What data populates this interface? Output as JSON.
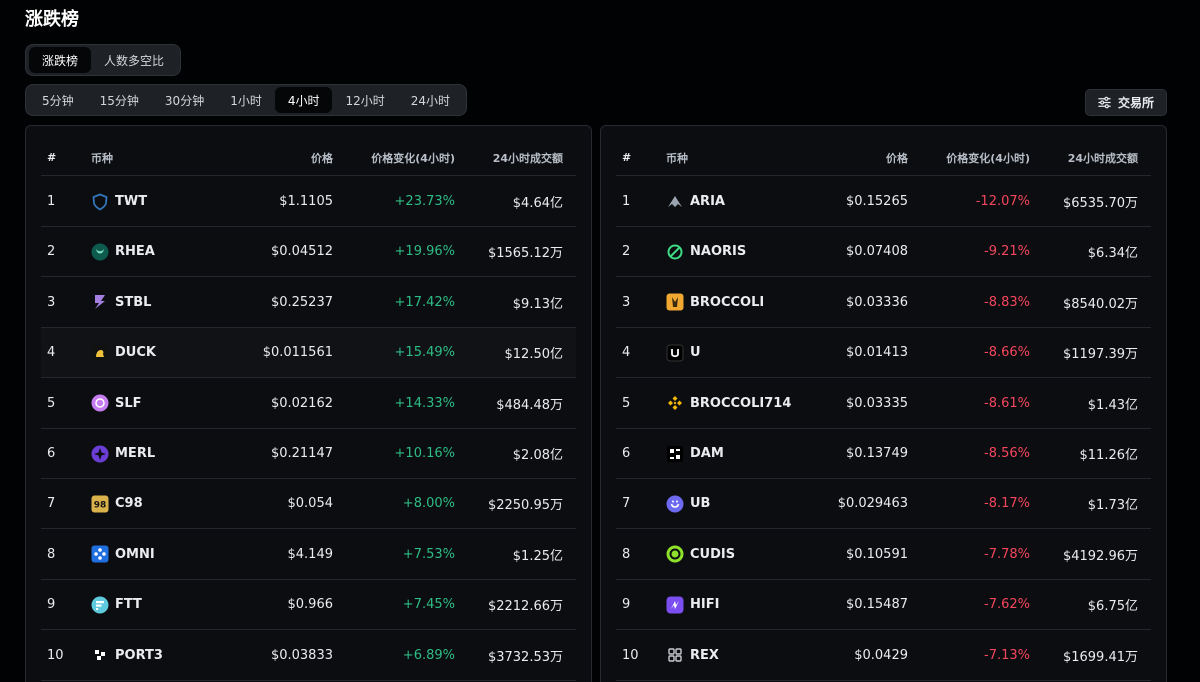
{
  "page": {
    "title": "涨跌榜"
  },
  "main_tabs": [
    {
      "label": "涨跌榜",
      "active": true
    },
    {
      "label": "人数多空比",
      "active": false
    }
  ],
  "time_tabs": [
    {
      "label": "5分钟",
      "active": false
    },
    {
      "label": "15分钟",
      "active": false
    },
    {
      "label": "30分钟",
      "active": false
    },
    {
      "label": "1小时",
      "active": false
    },
    {
      "label": "4小时",
      "active": true
    },
    {
      "label": "12小时",
      "active": false
    },
    {
      "label": "24小时",
      "active": false
    }
  ],
  "exchange_button": {
    "label": "交易所",
    "icon": "sliders-icon"
  },
  "columns": {
    "rank": "#",
    "coin": "币种",
    "price": "价格",
    "change": "价格变化(4小时)",
    "volume": "24小时成交额"
  },
  "colors": {
    "up": "#2ebd85",
    "down": "#f6465d",
    "background": "#010203",
    "panel": "#0b0d10"
  },
  "gainers": [
    {
      "rank": "1",
      "symbol": "TWT",
      "price": "$1.1105",
      "change": "+23.73%",
      "volume": "$4.64亿",
      "icon": "twt-shield-icon",
      "color": "#3375bb"
    },
    {
      "rank": "2",
      "symbol": "RHEA",
      "price": "$0.04512",
      "change": "+19.96%",
      "volume": "$1565.12万",
      "icon": "rhea-icon",
      "color": "#0e5a4c"
    },
    {
      "rank": "3",
      "symbol": "STBL",
      "price": "$0.25237",
      "change": "+17.42%",
      "volume": "$9.13亿",
      "icon": "stbl-icon",
      "color": "#a47fe0"
    },
    {
      "rank": "4",
      "symbol": "DUCK",
      "price": "$0.011561",
      "change": "+15.49%",
      "volume": "$12.50亿",
      "icon": "duck-icon",
      "color": "#f0c23b"
    },
    {
      "rank": "5",
      "symbol": "SLF",
      "price": "$0.02162",
      "change": "+14.33%",
      "volume": "$484.48万",
      "icon": "slf-icon",
      "color": "#c57df0"
    },
    {
      "rank": "6",
      "symbol": "MERL",
      "price": "$0.21147",
      "change": "+10.16%",
      "volume": "$2.08亿",
      "icon": "merl-icon",
      "color": "#6b3fd6"
    },
    {
      "rank": "7",
      "symbol": "C98",
      "price": "$0.054",
      "change": "+8.00%",
      "volume": "$2250.95万",
      "icon": "c98-icon",
      "color": "#d9b24c"
    },
    {
      "rank": "8",
      "symbol": "OMNI",
      "price": "$4.149",
      "change": "+7.53%",
      "volume": "$1.25亿",
      "icon": "omni-icon",
      "color": "#1f6fe0"
    },
    {
      "rank": "9",
      "symbol": "FTT",
      "price": "$0.966",
      "change": "+7.45%",
      "volume": "$2212.66万",
      "icon": "ftt-icon",
      "color": "#5fcade"
    },
    {
      "rank": "10",
      "symbol": "PORT3",
      "price": "$0.03833",
      "change": "+6.89%",
      "volume": "$3732.53万",
      "icon": "port3-icon",
      "color": "#ffffff"
    }
  ],
  "losers": [
    {
      "rank": "1",
      "symbol": "ARIA",
      "price": "$0.15265",
      "change": "-12.07%",
      "volume": "$6535.70万",
      "icon": "aria-icon",
      "color": "#9aa3b0"
    },
    {
      "rank": "2",
      "symbol": "NAORIS",
      "price": "$0.07408",
      "change": "-9.21%",
      "volume": "$6.34亿",
      "icon": "naoris-icon",
      "color": "#3ddc84"
    },
    {
      "rank": "3",
      "symbol": "BROCCOLI",
      "price": "$0.03336",
      "change": "-8.83%",
      "volume": "$8540.02万",
      "icon": "broccoli-icon",
      "color": "#f0a830"
    },
    {
      "rank": "4",
      "symbol": "U",
      "price": "$0.01413",
      "change": "-8.66%",
      "volume": "$1197.39万",
      "icon": "u-icon",
      "color": "#ffffff"
    },
    {
      "rank": "5",
      "symbol": "BROCCOLI714",
      "price": "$0.03335",
      "change": "-8.61%",
      "volume": "$1.43亿",
      "icon": "bnb-icon",
      "color": "#f0b90b"
    },
    {
      "rank": "6",
      "symbol": "DAM",
      "price": "$0.13749",
      "change": "-8.56%",
      "volume": "$11.26亿",
      "icon": "dam-icon",
      "color": "#ffffff"
    },
    {
      "rank": "7",
      "symbol": "UB",
      "price": "$0.029463",
      "change": "-8.17%",
      "volume": "$1.73亿",
      "icon": "ub-icon",
      "color": "#6d6af0"
    },
    {
      "rank": "8",
      "symbol": "CUDIS",
      "price": "$0.10591",
      "change": "-7.78%",
      "volume": "$4192.96万",
      "icon": "cudis-icon",
      "color": "#8ee02a"
    },
    {
      "rank": "9",
      "symbol": "HIFI",
      "price": "$0.15487",
      "change": "-7.62%",
      "volume": "$6.75亿",
      "icon": "hifi-icon",
      "color": "#7b4ef0"
    },
    {
      "rank": "10",
      "symbol": "REX",
      "price": "$0.0429",
      "change": "-7.13%",
      "volume": "$1699.41万",
      "icon": "rex-icon",
      "color": "#c9ccd1"
    }
  ]
}
